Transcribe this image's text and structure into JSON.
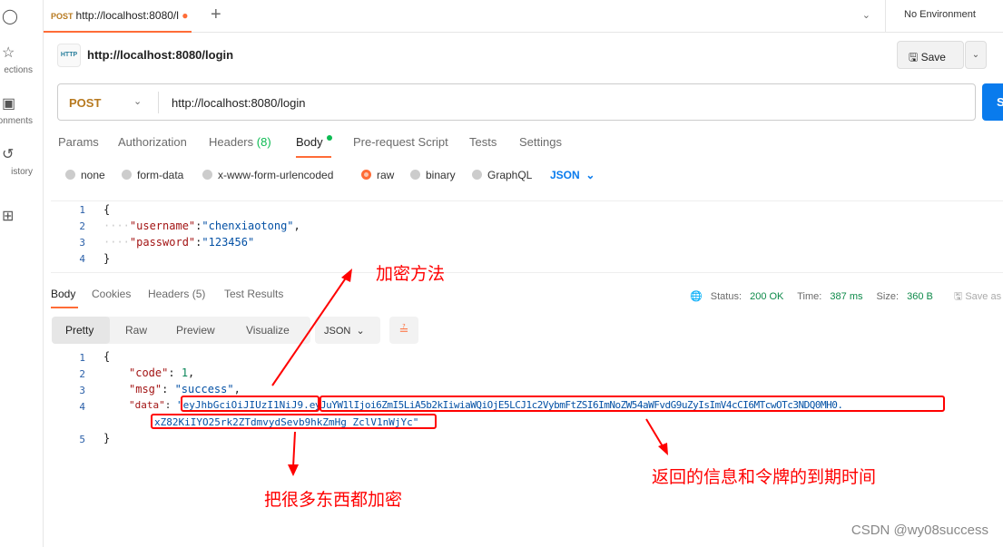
{
  "sidebar": {
    "items": [
      {
        "label": "",
        "icon": "user-icon"
      },
      {
        "label": "ections",
        "icon": "collections-icon"
      },
      {
        "label": "onments",
        "icon": "environments-icon"
      },
      {
        "label": "istory",
        "icon": "history-icon"
      },
      {
        "label": "",
        "icon": "apps-icon"
      }
    ]
  },
  "tab": {
    "method": "POST",
    "title": "http://localhost:8080/l"
  },
  "environment": "No Environment",
  "request": {
    "title": "http://localhost:8080/login",
    "method": "POST",
    "url": "http://localhost:8080/login",
    "save": "Save",
    "send": "S"
  },
  "req_tabs": [
    "Params",
    "Authorization",
    "Headers",
    "(8)",
    "Body",
    "Pre-request Script",
    "Tests",
    "Settings"
  ],
  "body_types": [
    "none",
    "form-data",
    "x-www-form-urlencoded",
    "raw",
    "binary",
    "GraphQL"
  ],
  "body_format": "JSON",
  "request_body": {
    "lines": [
      "1",
      "2",
      "3",
      "4"
    ],
    "open": "{",
    "k1": "\"username\"",
    "v1": "\"chenxiaotong\"",
    "k2": "\"password\"",
    "v2": "\"123456\"",
    "close": "}"
  },
  "res_tabs": [
    "Body",
    "Cookies",
    "Headers (5)",
    "Test Results"
  ],
  "status": {
    "label_status": "Status:",
    "status": "200 OK",
    "label_time": "Time:",
    "time": "387 ms",
    "label_size": "Size:",
    "size": "360 B",
    "save_as": "Save as"
  },
  "views": [
    "Pretty",
    "Raw",
    "Preview",
    "Visualize"
  ],
  "response_format": "JSON",
  "response": {
    "lines": [
      "1",
      "2",
      "3",
      "4",
      "5"
    ],
    "open": "{",
    "code_key": "\"code\"",
    "code_val": "1",
    "msg_key": "\"msg\"",
    "msg_val": "\"success\"",
    "data_key": "\"data\"",
    "token_header": "eyJhbGciOiJIUzI1NiJ9",
    "token_payload": "eyJuYW1lIjoi6ZmI5LiA5b2kIiwiaWQiOjE5LCJ1c2VybmFtZSI6ImNoZW54aWFvdG9uZyIsImV4cCI6MTcwOTc3NDQ0MH0",
    "token_sig": "xZ82KiIYO25rk2ZTdmvydSevb9hkZmHg_ZclV1nWjYc",
    "close": "}"
  },
  "annotations": {
    "method": "加密方法",
    "payload": "返回的信息和令牌的到期时间",
    "signature": "把很多东西都加密"
  },
  "watermark": "CSDN @wy08success",
  "colors": {
    "accent": "#ff6c37",
    "send": "#097bed",
    "annotation": "#ff0000"
  }
}
